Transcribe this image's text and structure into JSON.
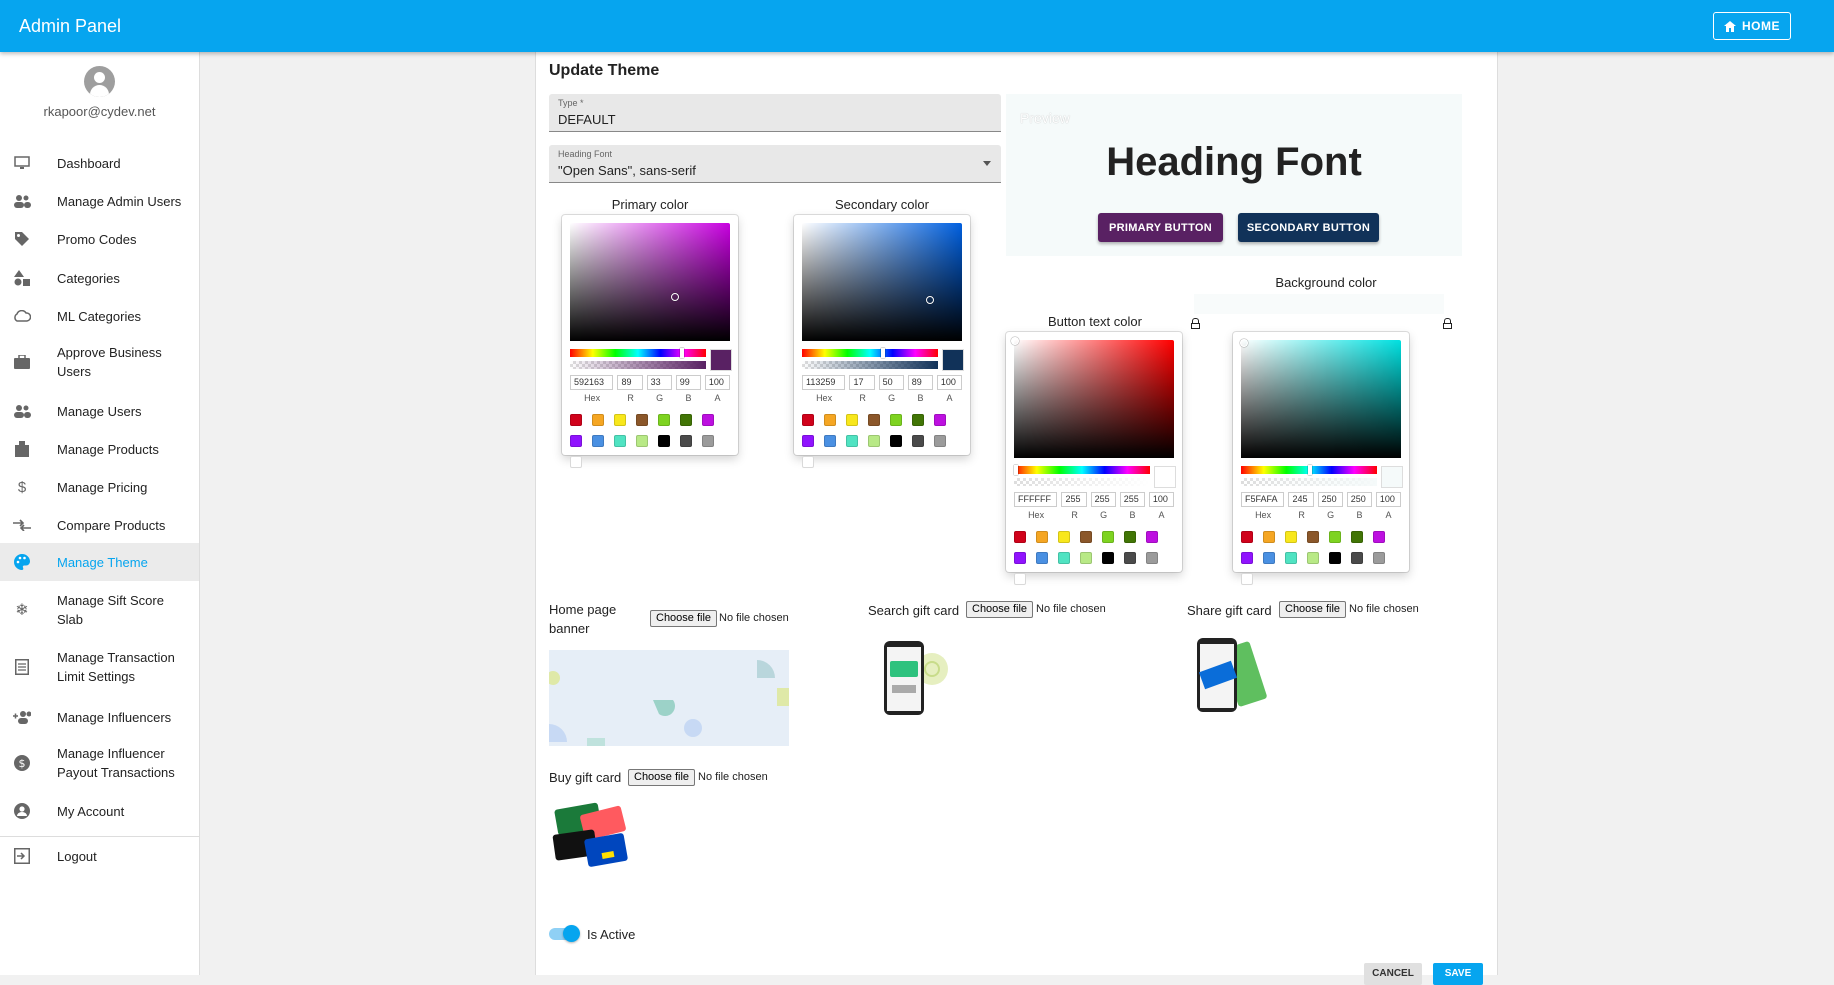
{
  "appbar": {
    "title": "Admin Panel",
    "home_label": "HOME"
  },
  "sidebar": {
    "email": "rkapoor@cydev.net",
    "items": [
      {
        "label": "Dashboard"
      },
      {
        "label": "Manage Admin Users"
      },
      {
        "label": "Promo Codes"
      },
      {
        "label": "Categories"
      },
      {
        "label": "ML Categories"
      },
      {
        "label": "Approve Business Users"
      },
      {
        "label": "Manage Users"
      },
      {
        "label": "Manage Products"
      },
      {
        "label": "Manage Pricing"
      },
      {
        "label": "Compare Products"
      },
      {
        "label": "Manage Theme"
      },
      {
        "label": "Manage Sift Score Slab"
      },
      {
        "label": "Manage Transaction Limit Settings"
      },
      {
        "label": "Manage Influencers"
      },
      {
        "label": "Manage Influencer Payout Transactions"
      },
      {
        "label": "My Account"
      },
      {
        "label": "Logout"
      }
    ]
  },
  "form": {
    "title": "Update Theme",
    "type_label": "Type *",
    "type_value": "DEFAULT",
    "font_label": "Heading Font",
    "font_value": "\"Open Sans\", sans-serif"
  },
  "pickers": {
    "primary": {
      "label": "Primary color",
      "hex": "592163",
      "r": "89",
      "g": "33",
      "b": "99",
      "a": "100",
      "color": "#592163"
    },
    "secondary": {
      "label": "Secondary color",
      "hex": "113259",
      "r": "17",
      "g": "50",
      "b": "89",
      "a": "100",
      "color": "#113259"
    },
    "button_text": {
      "label": "Button text color",
      "hex": "FFFFFF",
      "r": "255",
      "g": "255",
      "b": "255",
      "a": "100",
      "color": "#FFFFFF"
    },
    "background": {
      "label": "Background color",
      "hex": "F5FAFA",
      "r": "245",
      "g": "250",
      "b": "250",
      "a": "100",
      "color": "#F5FAFA"
    },
    "input_labels": {
      "hex": "Hex",
      "r": "R",
      "g": "G",
      "b": "B",
      "a": "A"
    },
    "presets": [
      "#D0021B",
      "#F5A623",
      "#F8E71C",
      "#8B572A",
      "#7ED321",
      "#417505",
      "#BD10E0",
      "#9013FE",
      "#4A90E2",
      "#50E3C2",
      "#B8E986",
      "#000000",
      "#4A4A4A",
      "#9B9B9B",
      "#FFFFFF"
    ]
  },
  "preview": {
    "label": "Preview",
    "heading": "Heading Font",
    "primary_button": "PRIMARY BUTTON",
    "secondary_button": "SECONDARY BUTTON"
  },
  "uploads": {
    "choose_label": "Choose file",
    "no_file": "No file chosen",
    "home_banner": "Home page banner",
    "search_card": "Search gift card",
    "share_card": "Share gift card",
    "buy_card": "Buy gift card"
  },
  "active": {
    "label": "Is Active",
    "on": true
  },
  "actions": {
    "cancel": "CANCEL",
    "save": "SAVE"
  },
  "colors": {
    "accent": "#06A5EF",
    "primary": "#592163",
    "secondary": "#113259"
  }
}
